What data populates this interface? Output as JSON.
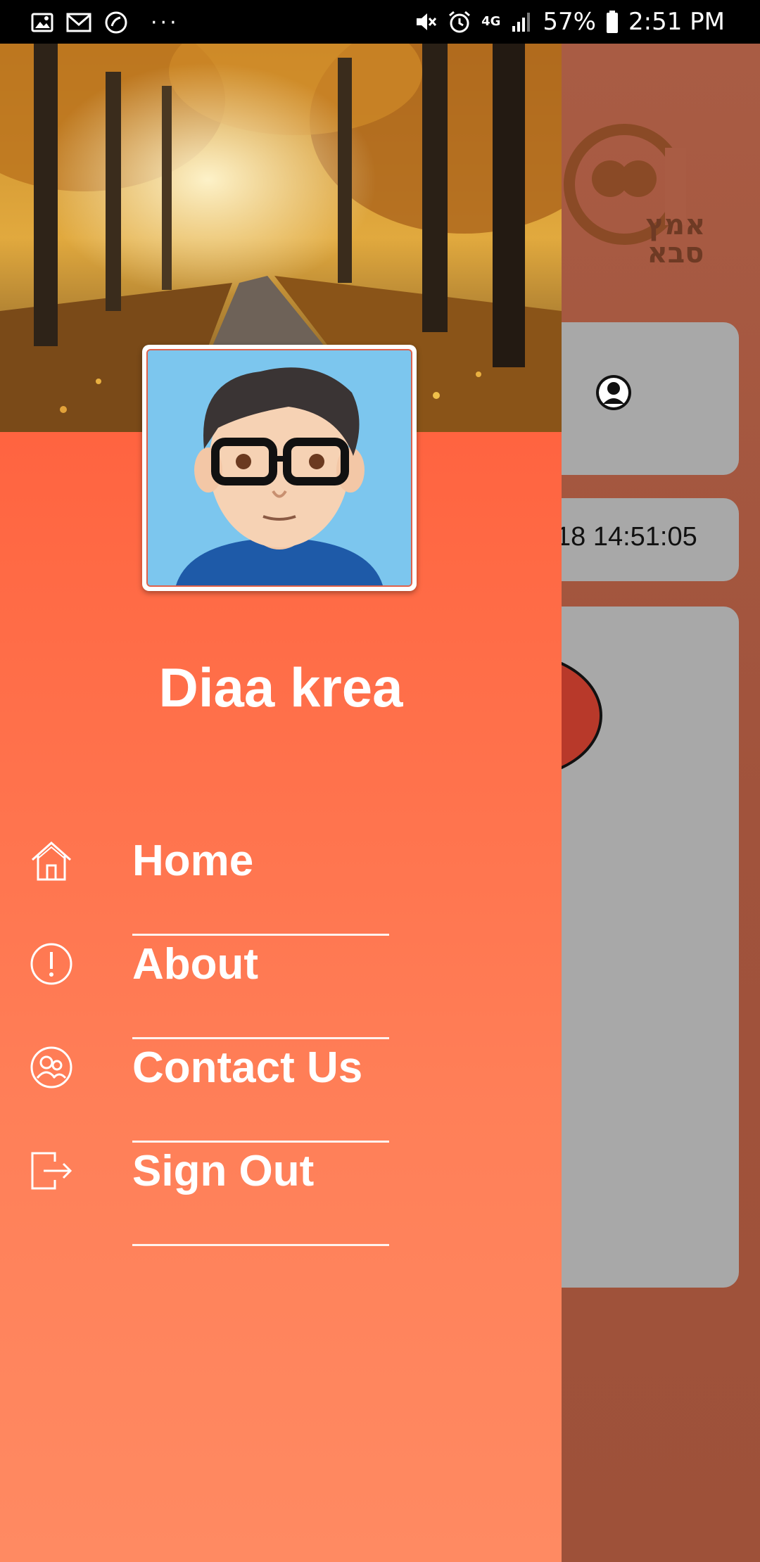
{
  "status_bar": {
    "battery": "57%",
    "time": "2:51 PM",
    "network": "4G",
    "left_icons": [
      "gallery-icon",
      "gmail-icon",
      "phone-icon",
      "more-dots-icon"
    ],
    "right_icons": [
      "mute-icon",
      "alarm-icon",
      "network-4g-icon",
      "signal-icon",
      "battery-icon"
    ]
  },
  "background_app": {
    "logo_text": "אמץ סבא",
    "timestamp": "18 14:51:05"
  },
  "drawer": {
    "user_name": "Diaa krea",
    "menu": [
      {
        "label": "Home",
        "icon": "home-icon"
      },
      {
        "label": "About",
        "icon": "info-icon"
      },
      {
        "label": "Contact Us",
        "icon": "contacts-icon"
      },
      {
        "label": "Sign Out",
        "icon": "sign-out-icon"
      }
    ]
  },
  "colors": {
    "drawer_top": "#ff5233",
    "drawer_bottom": "#ff8a62",
    "background_app": "#a1533c",
    "card": "#a8a8a8"
  }
}
